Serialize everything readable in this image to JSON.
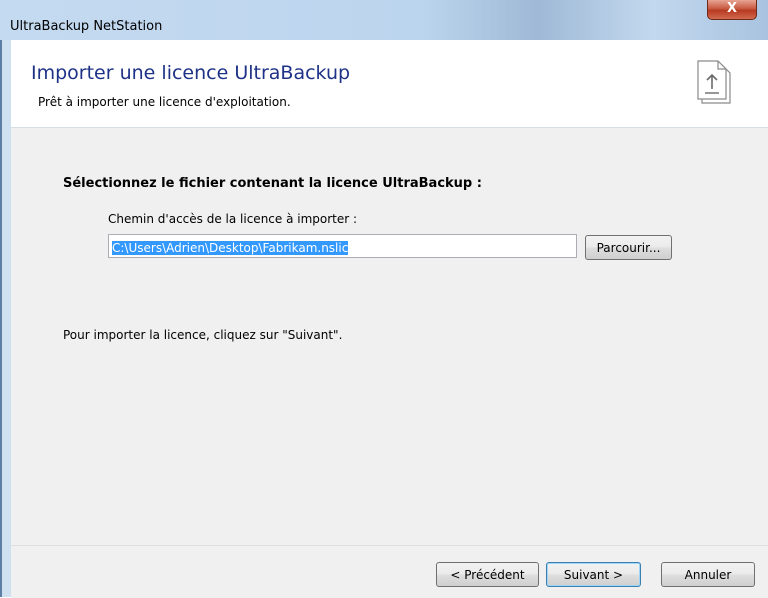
{
  "window": {
    "title": "UltraBackup NetStation",
    "close_label": "X"
  },
  "header": {
    "title": "Importer une licence UltraBackup",
    "subtitle": "Prêt à importer une licence d'exploitation.",
    "icon": "import-certificate-icon"
  },
  "main": {
    "prompt": "Sélectionnez le fichier contenant la licence UltraBackup :",
    "path_label": "Chemin d'accès de la licence à importer :",
    "path_value": "C:\\Users\\Adrien\\Desktop\\Fabrikam.nslic",
    "browse_label": "Parcourir...",
    "hint": "Pour importer la licence, cliquez sur \"Suivant\"."
  },
  "footer": {
    "prev_label": "< Précédent",
    "next_label": "Suivant >",
    "cancel_label": "Annuler"
  },
  "colors": {
    "header_title": "#1e3287",
    "selection": "#3399ff",
    "dialog_body": "#f0f0f0"
  }
}
